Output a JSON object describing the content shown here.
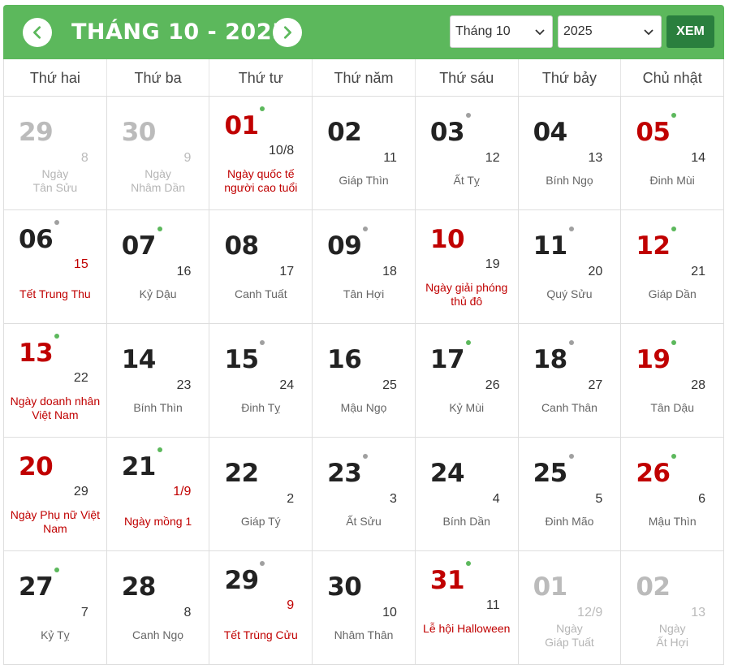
{
  "header": {
    "title": "THÁNG 10 - 2025",
    "month_select": "Tháng 10",
    "year_select": "2025",
    "view_button": "XEM"
  },
  "colors": {
    "header_bg": "#5cb85c",
    "button_bg": "#2a7f3e",
    "holiday_red": "#c00000",
    "muted": "#bbbbbb"
  },
  "weekdays": [
    "Thứ hai",
    "Thứ ba",
    "Thứ tư",
    "Thứ năm",
    "Thứ sáu",
    "Thứ bảy",
    "Chủ nhật"
  ],
  "weeks": [
    [
      {
        "solar": "29",
        "lunar": "8",
        "canchi": "Ngày\nTân Sửu",
        "muted": true
      },
      {
        "solar": "30",
        "lunar": "9",
        "canchi": "Ngày\nNhâm Dần",
        "muted": true
      },
      {
        "solar": "01",
        "lunar": "10/8",
        "event": "Ngày quốc tế người cao tuổi",
        "red": true,
        "dot": "green"
      },
      {
        "solar": "02",
        "lunar": "11",
        "canchi": "Giáp Thìn"
      },
      {
        "solar": "03",
        "lunar": "12",
        "canchi": "Ất Tỵ",
        "dot": "grey"
      },
      {
        "solar": "04",
        "lunar": "13",
        "canchi": "Bính Ngọ"
      },
      {
        "solar": "05",
        "lunar": "14",
        "canchi": "Đinh Mùi",
        "red": true,
        "dot": "green"
      }
    ],
    [
      {
        "solar": "06",
        "lunar": "15",
        "event": "Tết Trung Thu",
        "lunar_red": true,
        "dot": "grey"
      },
      {
        "solar": "07",
        "lunar": "16",
        "canchi": "Kỷ Dậu",
        "dot": "green"
      },
      {
        "solar": "08",
        "lunar": "17",
        "canchi": "Canh Tuất"
      },
      {
        "solar": "09",
        "lunar": "18",
        "canchi": "Tân Hợi",
        "dot": "grey"
      },
      {
        "solar": "10",
        "lunar": "19",
        "event": "Ngày giải phóng thủ đô",
        "red": true
      },
      {
        "solar": "11",
        "lunar": "20",
        "canchi": "Quý Sửu",
        "dot": "grey"
      },
      {
        "solar": "12",
        "lunar": "21",
        "canchi": "Giáp Dần",
        "red": true,
        "dot": "green"
      }
    ],
    [
      {
        "solar": "13",
        "lunar": "22",
        "event": "Ngày doanh nhân Việt Nam",
        "red": true,
        "dot": "green"
      },
      {
        "solar": "14",
        "lunar": "23",
        "canchi": "Bính Thìn"
      },
      {
        "solar": "15",
        "lunar": "24",
        "canchi": "Đinh Tỵ",
        "dot": "grey"
      },
      {
        "solar": "16",
        "lunar": "25",
        "canchi": "Mậu Ngọ"
      },
      {
        "solar": "17",
        "lunar": "26",
        "canchi": "Kỷ Mùi",
        "dot": "green"
      },
      {
        "solar": "18",
        "lunar": "27",
        "canchi": "Canh Thân",
        "dot": "grey"
      },
      {
        "solar": "19",
        "lunar": "28",
        "canchi": "Tân Dậu",
        "red": true,
        "dot": "green"
      }
    ],
    [
      {
        "solar": "20",
        "lunar": "29",
        "event": "Ngày Phụ nữ Việt Nam",
        "red": true
      },
      {
        "solar": "21",
        "lunar": "1/9",
        "event": "Ngày mồng 1",
        "lunar_red": true,
        "dot": "green"
      },
      {
        "solar": "22",
        "lunar": "2",
        "canchi": "Giáp Tý"
      },
      {
        "solar": "23",
        "lunar": "3",
        "canchi": "Ất Sửu",
        "dot": "grey"
      },
      {
        "solar": "24",
        "lunar": "4",
        "canchi": "Bính Dần"
      },
      {
        "solar": "25",
        "lunar": "5",
        "canchi": "Đinh Mão",
        "dot": "grey"
      },
      {
        "solar": "26",
        "lunar": "6",
        "canchi": "Mậu Thìn",
        "red": true,
        "dot": "green"
      }
    ],
    [
      {
        "solar": "27",
        "lunar": "7",
        "canchi": "Kỷ Tỵ",
        "dot": "green"
      },
      {
        "solar": "28",
        "lunar": "8",
        "canchi": "Canh Ngọ"
      },
      {
        "solar": "29",
        "lunar": "9",
        "event": "Tết Trùng Cửu",
        "lunar_red": true,
        "dot": "grey"
      },
      {
        "solar": "30",
        "lunar": "10",
        "canchi": "Nhâm Thân"
      },
      {
        "solar": "31",
        "lunar": "11",
        "event": "Lễ hội Halloween",
        "red": true,
        "dot": "green"
      },
      {
        "solar": "01",
        "lunar": "12/9",
        "canchi": "Ngày\nGiáp Tuất",
        "muted": true
      },
      {
        "solar": "02",
        "lunar": "13",
        "canchi": "Ngày\nẤt Hợi",
        "muted": true,
        "red": true
      }
    ]
  ]
}
